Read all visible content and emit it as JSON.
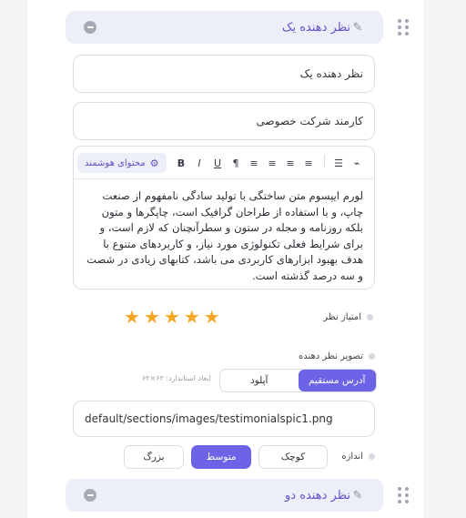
{
  "item1": {
    "title": "نظر دهنده یک"
  },
  "fields": {
    "name_value": "نظر دهنده یک",
    "position_value": "کارمند شرکت خصوصی"
  },
  "editor": {
    "ai_label": "محتوای هوشمند",
    "tools": [
      "B",
      "I",
      "U",
      "¶",
      "≡",
      "≡",
      "≡",
      "≡",
      "≣",
      "☰",
      "🔗"
    ],
    "text": "لورم ایپسوم متن ساختگی با تولید سادگی نامفهوم از صنعت چاپ، و با استفاده از طراحان گرافیک است، چاپگرها و متون بلکه روزنامه و مجله در ستون و سطرآنچنان که لازم است، و برای شرایط فعلی تکنولوژی مورد نیاز، و کاربردهای متنوع با هدف بهبود ابزارهای کاربردی می باشد، کتابهای زیادی در شصت و سه درصد گذشته است."
  },
  "rating": {
    "label": "امتیاز نظر",
    "value": 5,
    "max": 5
  },
  "image": {
    "label": "تصویر نظر دهنده",
    "tabs": [
      "آدرس مستقیم",
      "آپلود"
    ],
    "active_tab": "آدرس مستقیم",
    "hint": "ابعاد استاندارد: ۶۲×۶۲",
    "path": "default/sections/images/testimonialspic1.png"
  },
  "size": {
    "label": "اندازه",
    "options": [
      "کوچک",
      "متوسط",
      "بزرگ"
    ],
    "selected": "متوسط"
  },
  "item2": {
    "title": "نظر دهنده دو"
  },
  "colors": {
    "accent": "#6c63e6",
    "star": "#f5a623",
    "accordion_bg": "#eceef8"
  }
}
